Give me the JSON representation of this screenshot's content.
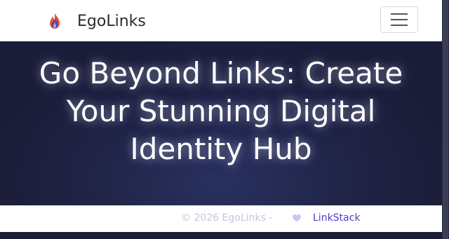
{
  "navbar": {
    "brand_name": "EgoLinks",
    "logo_icon": "flame-logo-icon",
    "toggler_icon": "hamburger-menu-icon"
  },
  "hero": {
    "title_line1": "Go Beyond Links: Create",
    "title_line2": "Your Stunning Digital",
    "title_line3": "Identity Hub"
  },
  "footer": {
    "copyright": "© 2026 EgoLinks -",
    "heart_icon": "heart-icon",
    "link_label": "LinkStack"
  },
  "colors": {
    "hero_background": "#1b1d35",
    "accent": "#4a3fc7",
    "footer_text": "#c4c6e0"
  }
}
